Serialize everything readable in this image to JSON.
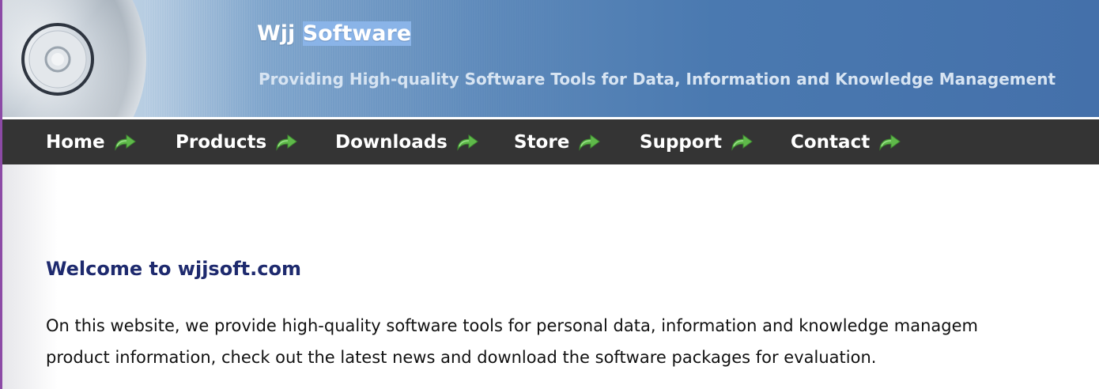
{
  "header": {
    "title_part1": "Wjj ",
    "title_part2_selected": "Software",
    "tagline": "Providing High-quality Software Tools for Data, Information and Knowledge Management",
    "logo_icon": "cd-disc-icon"
  },
  "nav": {
    "items": [
      {
        "label": "Home",
        "icon": "green-arrow-icon"
      },
      {
        "label": "Products",
        "icon": "green-arrow-icon"
      },
      {
        "label": "Downloads",
        "icon": "green-arrow-icon"
      },
      {
        "label": "Store",
        "icon": "green-arrow-icon"
      },
      {
        "label": "Support",
        "icon": "green-arrow-icon"
      },
      {
        "label": "Contact",
        "icon": "green-arrow-icon"
      }
    ]
  },
  "main": {
    "heading": "Welcome to wjjsoft.com",
    "paragraph_line1": "On this website, we provide high-quality software tools for personal data, information and knowledge managem",
    "paragraph_line2": "product information, check out the latest news and download the software packages for evaluation."
  },
  "colors": {
    "nav_background": "#343434",
    "heading": "#1e2a6e",
    "arrow_green": "#5fb94a",
    "header_blue": "#4a79b0"
  }
}
